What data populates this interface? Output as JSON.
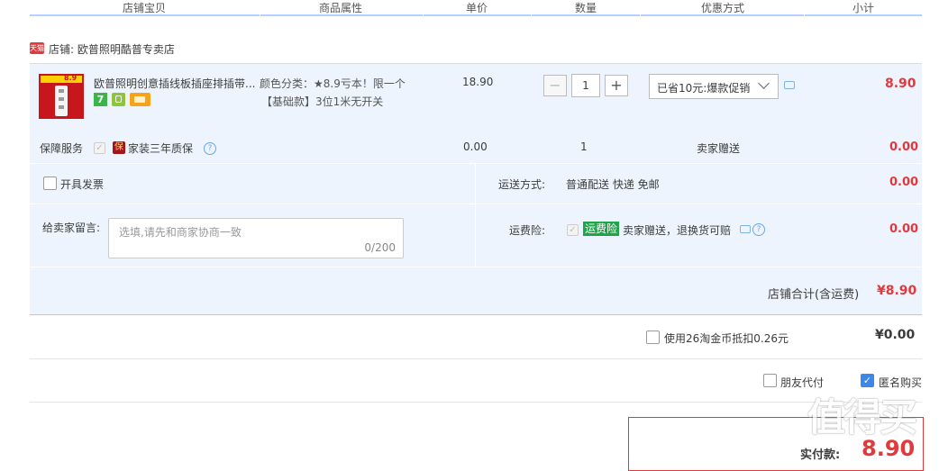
{
  "header": {
    "col_item": "店铺宝贝",
    "col_attr": "商品属性",
    "col_price": "单价",
    "col_qty": "数量",
    "col_promo": "优惠方式",
    "col_subtotal": "小计"
  },
  "shop": {
    "badge": "天猫",
    "name": "店铺: 欧普照明酷普专卖店"
  },
  "item": {
    "title": "欧普照明创意插线板插座排插带...",
    "attr_line1": "颜色分类：★8.9亏本！限一个",
    "attr_line2": "【基础款】3位1米无开关",
    "thumb_price": "8.9",
    "unit_price": "18.90",
    "qty": "1",
    "qty_minus": "−",
    "qty_plus": "+",
    "promo": "已省10元:爆款促销",
    "subtotal": "8.90",
    "icon_badge_7": "7"
  },
  "service": {
    "label": "保障服务",
    "badge": "保",
    "name": "家装三年质保",
    "price": "0.00",
    "qty": "1",
    "gift": "卖家赠送",
    "subtotal": "0.00"
  },
  "invoice": {
    "label": "开具发票"
  },
  "shipping": {
    "label": "运送方式:",
    "value": "普通配送 快递 免邮",
    "price": "0.00"
  },
  "message": {
    "label": "给卖家留言:",
    "placeholder": "选填,请先和商家协商一致",
    "counter": "0/200"
  },
  "insurance": {
    "label": "运费险:",
    "tag": "运费险",
    "desc": "卖家赠送，退换货可赔",
    "price": "0.00"
  },
  "shop_total": {
    "label": "店铺合计(含运费)",
    "value": "¥8.90"
  },
  "coins": {
    "label": "使用26淘金币抵扣0.26元",
    "value": "¥0.00"
  },
  "options": {
    "friend_pay": "朋友代付",
    "anonymous": "匿名购买"
  },
  "pay": {
    "label": "实付款:",
    "value": "8.90"
  },
  "watermark": "值得买"
}
